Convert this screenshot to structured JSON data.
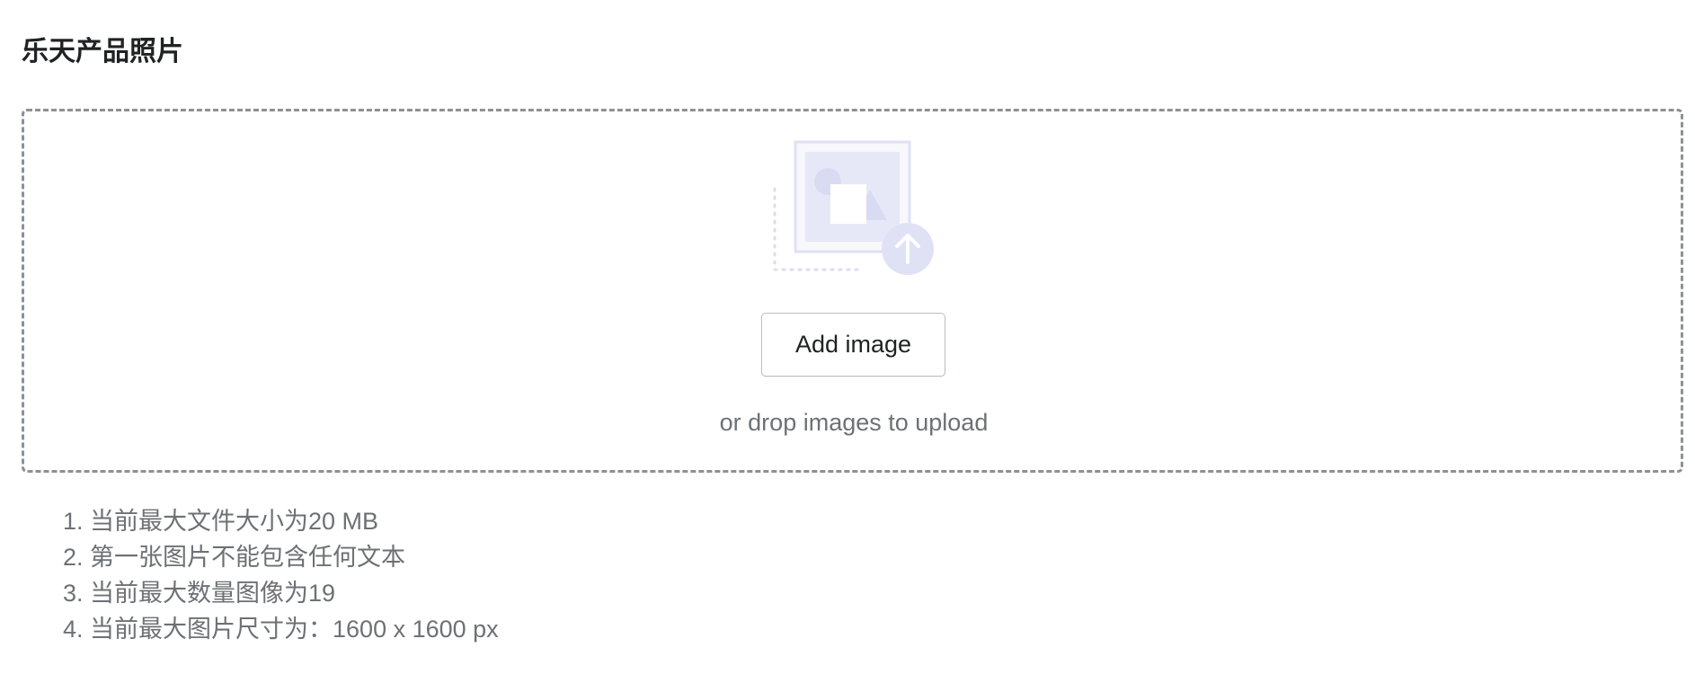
{
  "section": {
    "title": "乐天产品照片"
  },
  "dropzone": {
    "add_button_label": "Add image",
    "hint": "or drop images to upload",
    "illustration_icon": "image-upload-illustration-icon"
  },
  "rules": [
    "1. 当前最大文件大小为20 MB",
    "2. 第一张图片不能包含任何文本",
    "3. 当前最大数量图像为19",
    "4. 当前最大图片尺寸为：1600 x 1600 px"
  ],
  "colors": {
    "title": "#202223",
    "secondary_text": "#6d7175",
    "dropzone_border": "#8c9196",
    "illustration_fill": "#e4e5f7"
  }
}
